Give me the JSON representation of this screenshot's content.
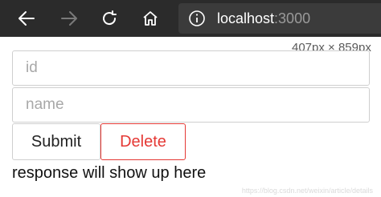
{
  "browser": {
    "url_host": "localhost",
    "url_port": ":3000",
    "icons": [
      "back-arrow-icon",
      "forward-arrow-icon",
      "reload-icon",
      "home-icon",
      "info-icon"
    ]
  },
  "overlay": {
    "dimensions": "407px × 859px"
  },
  "form": {
    "id_placeholder": "id",
    "name_placeholder": "name",
    "submit_label": "Submit",
    "delete_label": "Delete",
    "delete_color": "#e53935"
  },
  "response_text": "response will show up here",
  "watermark": "https://blog.csdn.net/weixin/article/details"
}
